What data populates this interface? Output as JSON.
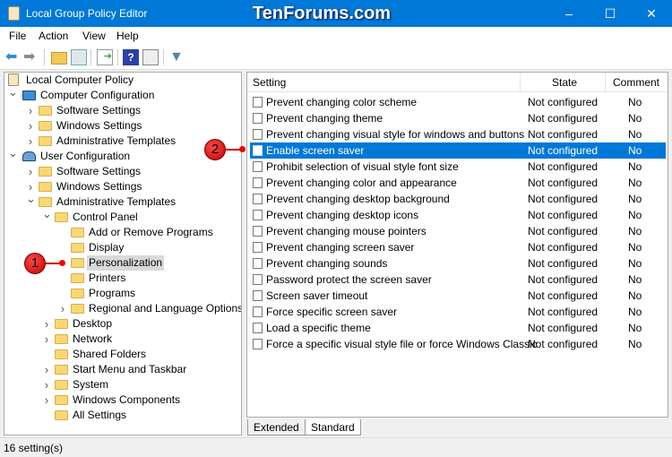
{
  "window": {
    "title": "Local Group Policy Editor",
    "watermark": "TenForums.com",
    "minimize": "–",
    "maximize": "☐",
    "close": "✕"
  },
  "menu": [
    "File",
    "Action",
    "View",
    "Help"
  ],
  "toolbar": [
    "back-icon",
    "forward-icon",
    "up-folder-icon",
    "show-hide-tree-icon",
    "export-list-icon",
    "help-icon",
    "show-hide-action-pane-icon",
    "filter-icon"
  ],
  "tree": [
    {
      "label": "Local Computer Policy",
      "level": 0,
      "chev": "",
      "icon": "policy"
    },
    {
      "label": "Computer Configuration",
      "level": 0,
      "chev": "v",
      "icon": "computer"
    },
    {
      "label": "Software Settings",
      "level": 1,
      "chev": ">",
      "icon": "folder"
    },
    {
      "label": "Windows Settings",
      "level": 1,
      "chev": ">",
      "icon": "folder"
    },
    {
      "label": "Administrative Templates",
      "level": 1,
      "chev": ">",
      "icon": "folder"
    },
    {
      "label": "User Configuration",
      "level": 0,
      "chev": "v",
      "icon": "user"
    },
    {
      "label": "Software Settings",
      "level": 1,
      "chev": ">",
      "icon": "folder"
    },
    {
      "label": "Windows Settings",
      "level": 1,
      "chev": ">",
      "icon": "folder"
    },
    {
      "label": "Administrative Templates",
      "level": 1,
      "chev": "v",
      "icon": "folder"
    },
    {
      "label": "Control Panel",
      "level": 2,
      "chev": "v",
      "icon": "folder"
    },
    {
      "label": "Add or Remove Programs",
      "level": 3,
      "chev": "",
      "icon": "folder"
    },
    {
      "label": "Display",
      "level": 3,
      "chev": "",
      "icon": "folder"
    },
    {
      "label": "Personalization",
      "level": 3,
      "chev": "",
      "icon": "folder",
      "selected": true
    },
    {
      "label": "Printers",
      "level": 3,
      "chev": "",
      "icon": "folder"
    },
    {
      "label": "Programs",
      "level": 3,
      "chev": "",
      "icon": "folder"
    },
    {
      "label": "Regional and Language Options",
      "level": 3,
      "chev": ">",
      "icon": "folder"
    },
    {
      "label": "Desktop",
      "level": 2,
      "chev": ">",
      "icon": "folder"
    },
    {
      "label": "Network",
      "level": 2,
      "chev": ">",
      "icon": "folder"
    },
    {
      "label": "Shared Folders",
      "level": 2,
      "chev": "",
      "icon": "folder"
    },
    {
      "label": "Start Menu and Taskbar",
      "level": 2,
      "chev": ">",
      "icon": "folder"
    },
    {
      "label": "System",
      "level": 2,
      "chev": ">",
      "icon": "folder"
    },
    {
      "label": "Windows Components",
      "level": 2,
      "chev": ">",
      "icon": "folder"
    },
    {
      "label": "All Settings",
      "level": 2,
      "chev": "",
      "icon": "folder"
    }
  ],
  "list": {
    "columns": [
      "Setting",
      "State",
      "Comment"
    ],
    "rows": [
      [
        "Prevent changing color scheme",
        "Not configured",
        "No"
      ],
      [
        "Prevent changing theme",
        "Not configured",
        "No"
      ],
      [
        "Prevent changing visual style for windows and buttons",
        "Not configured",
        "No"
      ],
      [
        "Enable screen saver",
        "Not configured",
        "No"
      ],
      [
        "Prohibit selection of visual style font size",
        "Not configured",
        "No"
      ],
      [
        "Prevent changing color and appearance",
        "Not configured",
        "No"
      ],
      [
        "Prevent changing desktop background",
        "Not configured",
        "No"
      ],
      [
        "Prevent changing desktop icons",
        "Not configured",
        "No"
      ],
      [
        "Prevent changing mouse pointers",
        "Not configured",
        "No"
      ],
      [
        "Prevent changing screen saver",
        "Not configured",
        "No"
      ],
      [
        "Prevent changing sounds",
        "Not configured",
        "No"
      ],
      [
        "Password protect the screen saver",
        "Not configured",
        "No"
      ],
      [
        "Screen saver timeout",
        "Not configured",
        "No"
      ],
      [
        "Force specific screen saver",
        "Not configured",
        "No"
      ],
      [
        "Load a specific theme",
        "Not configured",
        "No"
      ],
      [
        "Force a specific visual style file or force Windows Classic",
        "Not configured",
        "No"
      ]
    ],
    "selected_index": 3
  },
  "tabs": [
    "Extended",
    "Standard"
  ],
  "active_tab": "Standard",
  "status": "16 setting(s)",
  "callouts": [
    "1",
    "2"
  ],
  "colors": {
    "accent": "#0078d7",
    "callout": "#e00000"
  }
}
